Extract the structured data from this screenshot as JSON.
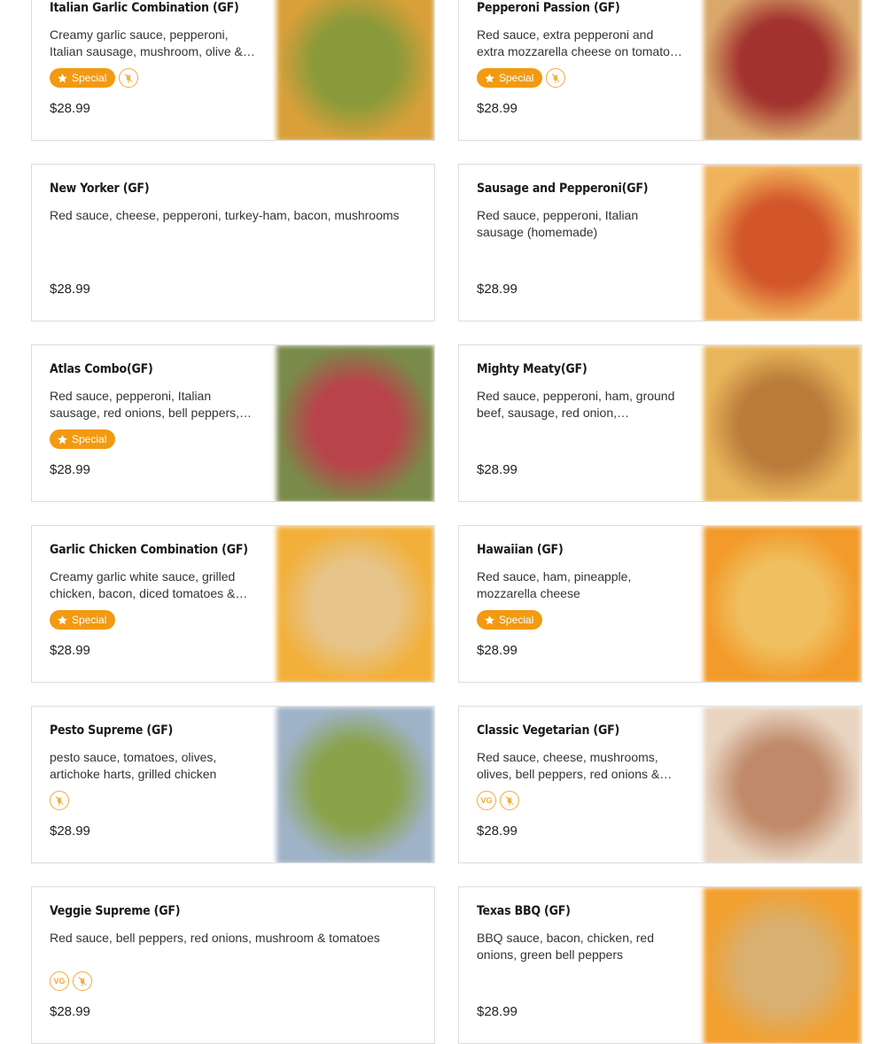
{
  "menu": {
    "special_label": "Special",
    "vegetarian_badge": "VG",
    "items": [
      {
        "title": "Italian Garlic Combination (GF)",
        "description": "Creamy garlic sauce, pepperoni, Italian sausage, mushroom, olive & green peppers",
        "price": "$28.99",
        "badges": [
          "special",
          "gluten-free"
        ],
        "image_colors": [
          "#8a9a3a",
          "#d9a03a"
        ]
      },
      {
        "title": "Pepperoni Passion (GF)",
        "description": "Red sauce, extra pepperoni and extra mozzarella cheese on tomato sauce",
        "price": "$28.99",
        "badges": [
          "special",
          "gluten-free"
        ],
        "image_colors": [
          "#a2322e",
          "#d9a86a"
        ]
      },
      {
        "title": "New Yorker (GF)",
        "description": "Red sauce, cheese, pepperoni, turkey-ham, bacon, mushrooms",
        "price": "$28.99",
        "badges": [],
        "image_colors": []
      },
      {
        "title": "Sausage and Pepperoni(GF)",
        "description": "Red sauce, pepperoni, Italian sausage (homemade)",
        "price": "$28.99",
        "badges": [],
        "image_colors": [
          "#d2562a",
          "#f0b25a"
        ]
      },
      {
        "title": "Atlas Combo(GF)",
        "description": "Red sauce, pepperoni, Italian sausage, red onions, bell peppers, mushrooms",
        "price": "$28.99",
        "badges": [
          "special"
        ],
        "image_colors": [
          "#b9434a",
          "#7a8a4a"
        ]
      },
      {
        "title": "Mighty Meaty(GF)",
        "description": "Red sauce, pepperoni, ham, ground beef, sausage, red onion, mushrooms",
        "price": "$28.99",
        "badges": [],
        "image_colors": [
          "#b97a3a",
          "#e8b55a"
        ]
      },
      {
        "title": "Garlic Chicken Combination (GF)",
        "description": "Creamy garlic white sauce, grilled chicken, bacon, diced tomatoes & spinach",
        "price": "$28.99",
        "badges": [
          "special"
        ],
        "image_colors": [
          "#e6c48a",
          "#f2b03a"
        ]
      },
      {
        "title": "Hawaiian (GF)",
        "description": "Red sauce, ham, pineapple, mozzarella cheese",
        "price": "$28.99",
        "badges": [
          "special"
        ],
        "image_colors": [
          "#f0c060",
          "#f29a2a"
        ]
      },
      {
        "title": "Pesto Supreme (GF)",
        "description": "pesto sauce, tomatoes, olives, artichoke harts, grilled chicken",
        "price": "$28.99",
        "badges": [
          "gluten-free"
        ],
        "image_colors": [
          "#8aa24a",
          "#9fb3c8"
        ]
      },
      {
        "title": "Classic Vegetarian (GF)",
        "description": "Red sauce, cheese, mushrooms, olives, bell peppers, red onions & tomatoes",
        "price": "$28.99",
        "badges": [
          "vegetarian",
          "gluten-free"
        ],
        "image_colors": [
          "#c08a6a",
          "#e8d4c0"
        ]
      },
      {
        "title": "Veggie Supreme (GF)",
        "description": "Red sauce, bell peppers, red onions, mushroom & tomatoes",
        "price": "$28.99",
        "badges": [
          "vegetarian",
          "gluten-free"
        ],
        "image_colors": []
      },
      {
        "title": "Texas BBQ (GF)",
        "description": "BBQ sauce, bacon, chicken, red onions, green bell peppers",
        "price": "$28.99",
        "badges": [],
        "image_colors": [
          "#d9b070",
          "#f2a030"
        ]
      }
    ]
  }
}
